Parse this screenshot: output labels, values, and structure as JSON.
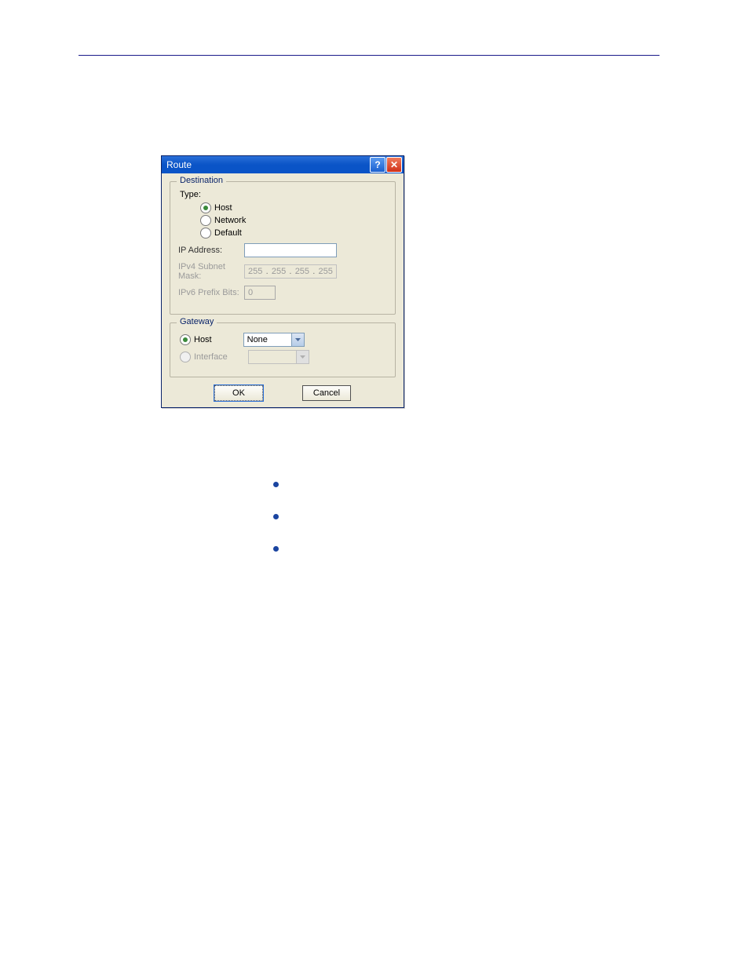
{
  "dialog": {
    "title": "Route",
    "destination": {
      "legend": "Destination",
      "type_label": "Type:",
      "options": {
        "host": "Host",
        "network": "Network",
        "default": "Default"
      },
      "selected": "host",
      "ip_address_label": "IP Address:",
      "ip_address_value": "",
      "subnet_mask_label": "IPv4 Subnet Mask:",
      "subnet_mask": {
        "a": "255",
        "b": "255",
        "c": "255",
        "d": "255"
      },
      "prefix_bits_label": "IPv6 Prefix Bits:",
      "prefix_bits_value": "0"
    },
    "gateway": {
      "legend": "Gateway",
      "host_label": "Host",
      "interface_label": "Interface",
      "selected": "host",
      "host_dropdown_value": "None",
      "interface_dropdown_value": ""
    },
    "buttons": {
      "ok": "OK",
      "cancel": "Cancel"
    }
  }
}
